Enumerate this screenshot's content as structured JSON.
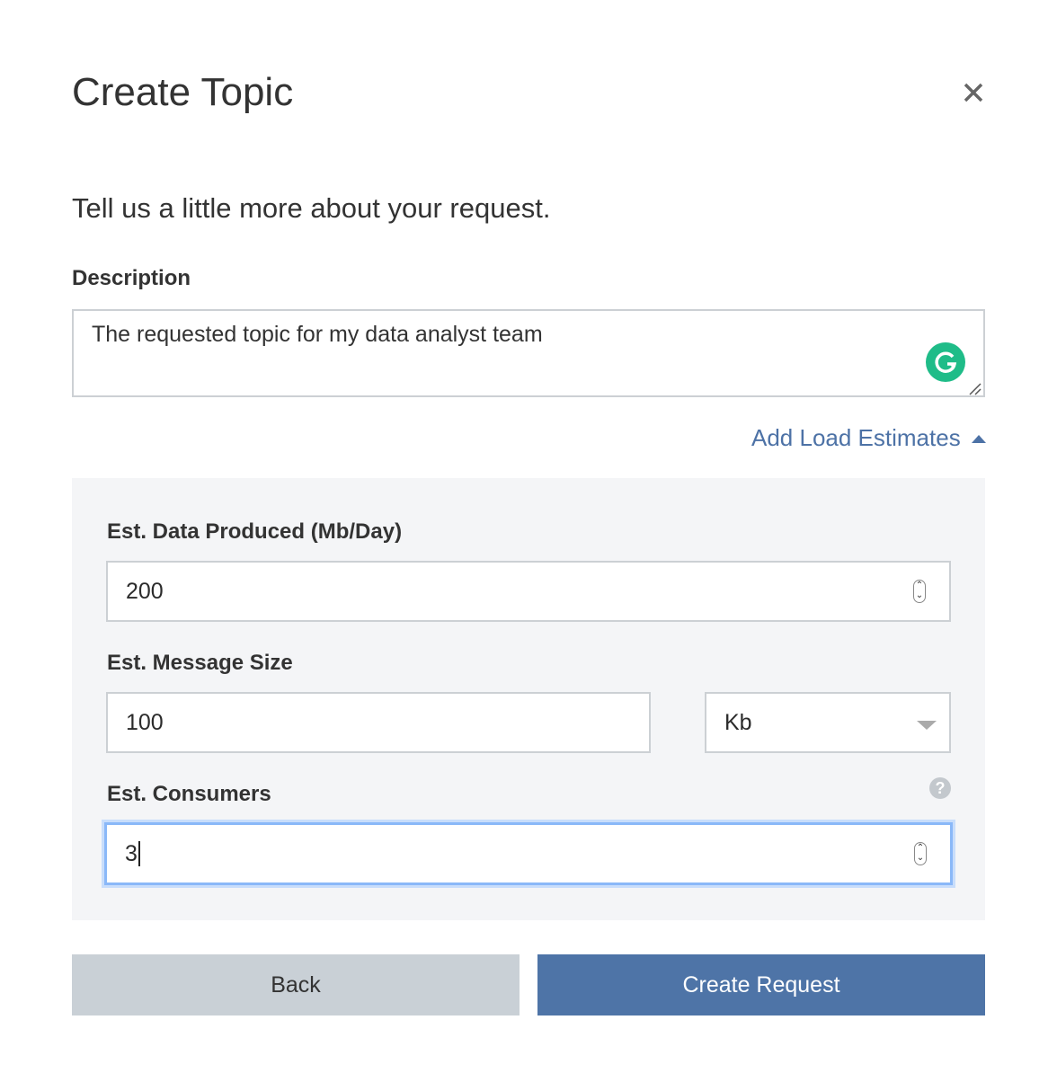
{
  "dialog": {
    "title": "Create Topic",
    "intro": "Tell us a little more about your request."
  },
  "description": {
    "label": "Description",
    "value": "The requested topic for my data analyst team"
  },
  "load_toggle": {
    "label": "Add Load Estimates",
    "expanded": true
  },
  "estimates": {
    "data_produced": {
      "label": "Est. Data Produced (Mb/Day)",
      "value": "200"
    },
    "message_size": {
      "label": "Est. Message Size",
      "value": "100",
      "unit": "Kb"
    },
    "consumers": {
      "label": "Est. Consumers",
      "value": "3"
    }
  },
  "buttons": {
    "back": "Back",
    "create": "Create Request"
  },
  "colors": {
    "accent": "#4e74a7",
    "grammarly": "#1fbc88",
    "focus": "#8ab8f8"
  }
}
